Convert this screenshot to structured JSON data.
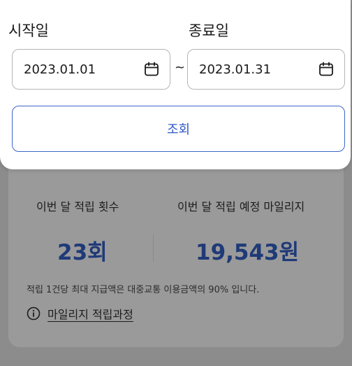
{
  "filter": {
    "start_label": "시작일",
    "end_label": "종료일",
    "start_date": "2023.01.01",
    "end_date": "2023.01.31",
    "range_separator": "~",
    "search_button": "조회",
    "calendar_icon": "calendar-icon"
  },
  "summary": {
    "count_label": "이번 달 적립 횟수",
    "points_label": "이번 달 적립 예정 마일리지",
    "count_value": "23회",
    "points_value": "19,543원",
    "note": "적립 1건당 최대 지급액은 대중교통 이용금액의 90% 입니다.",
    "process_link": "마일리지 적립과정",
    "info_icon": "info-icon"
  },
  "colors": {
    "accent": "#2f5ac4",
    "value_text": "#1f3a78",
    "overlay_background": "#8c8c8c"
  }
}
